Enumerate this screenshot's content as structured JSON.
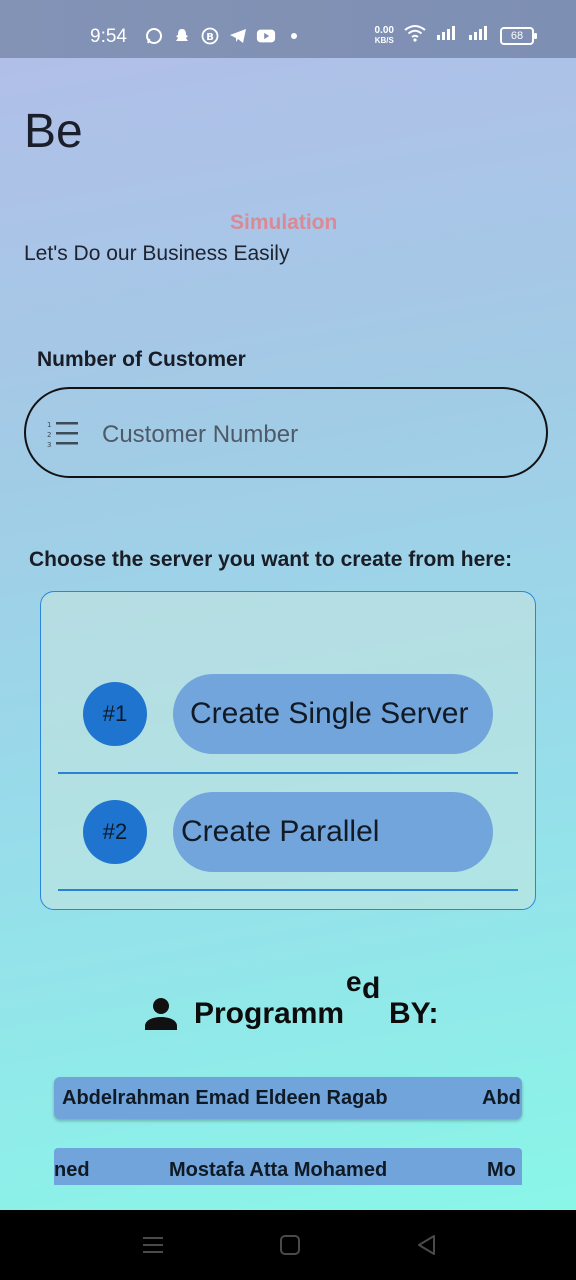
{
  "status_bar": {
    "time": "9:54",
    "notification_icons": [
      "whatsapp-icon",
      "snapchat-icon",
      "b-icon",
      "telegram-icon",
      "youtube-icon",
      "dot-icon"
    ],
    "net_speed_value": "0.00",
    "net_speed_unit": "KB/S",
    "battery": "68"
  },
  "header": {
    "title": "Be",
    "simulation_label": "Simulation",
    "tagline": "Let's Do our Business Easily"
  },
  "customer": {
    "label": "Number of Customer",
    "placeholder": "Customer Number",
    "value": ""
  },
  "servers": {
    "label": "Choose the server you want to create from here:",
    "items": [
      {
        "number": "#1",
        "button": "Create Single Server"
      },
      {
        "number": "#2",
        "button": "Create Parallel"
      }
    ]
  },
  "credits": {
    "heading_main": "Programm",
    "heading_sup_e": "e",
    "heading_sup_d": "d",
    "heading_by": "BY:",
    "row1": [
      "Abdelrahman Emad Eldeen Ragab",
      "Abd"
    ],
    "row2": [
      "ned",
      "Mostafa Atta Mohamed",
      "Mo"
    ]
  },
  "colors": {
    "accent": "#1f74cf",
    "button": "#71a5dc",
    "simulation": "#d98a96"
  }
}
